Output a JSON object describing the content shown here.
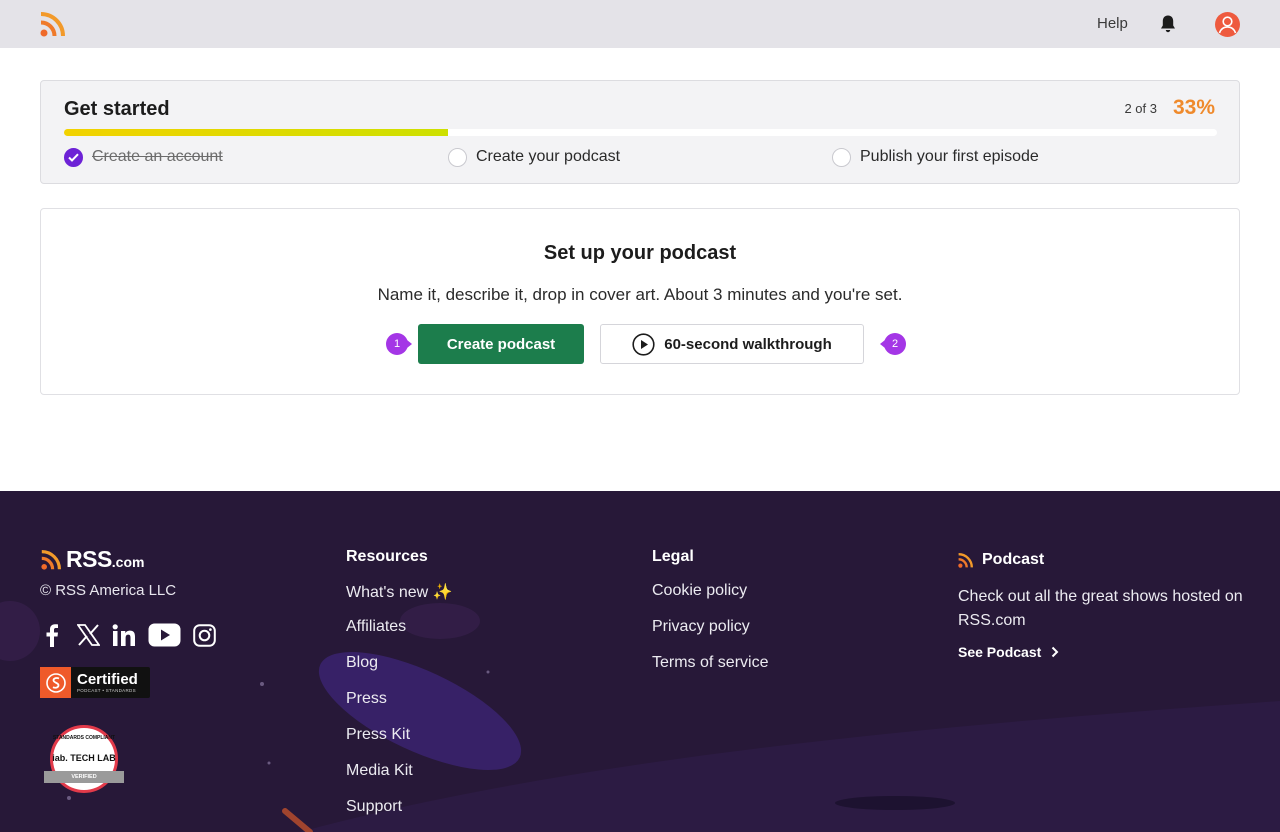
{
  "header": {
    "help_label": "Help"
  },
  "get_started": {
    "title": "Get started",
    "count_text": "2 of 3",
    "percent_text": "33%",
    "progress_fraction": 0.333,
    "steps": [
      {
        "label": "Create an account",
        "done": true
      },
      {
        "label": "Create your podcast",
        "done": false
      },
      {
        "label": "Publish your first episode",
        "done": false
      }
    ]
  },
  "setup": {
    "title": "Set up your podcast",
    "description": "Name it, describe it, drop in cover art. About 3 minutes and you're set.",
    "create_button": "Create podcast",
    "walkthrough_button": "60-second walkthrough",
    "marker_1": "1",
    "marker_2": "2"
  },
  "footer": {
    "logo_text": "RSS",
    "logo_suffix": ".com",
    "copyright": "© RSS America LLC",
    "social": [
      "facebook-icon",
      "x-icon",
      "linkedin-icon",
      "youtube-icon",
      "instagram-icon"
    ],
    "cert_label": "Certified",
    "cert_sub": "PODCAST • STANDARDS",
    "iab_top": "STANDARDS COMPLIANT",
    "iab_mid": "iab. TECH LAB",
    "iab_ribbon": "VERIFIED",
    "resources": {
      "title": "Resources",
      "items": [
        "What's new ✨",
        "Affiliates",
        "Blog",
        "Press",
        "Press Kit",
        "Media Kit",
        "Support"
      ]
    },
    "legal": {
      "title": "Legal",
      "items": [
        "Cookie policy",
        "Privacy policy",
        "Terms of service"
      ]
    },
    "podcast": {
      "title": "Podcast",
      "description": "Check out all the great shows hosted on RSS.com",
      "link": "See Podcast"
    }
  },
  "colors": {
    "accent_orange": "#ef8a2c",
    "progress_yellow": "#f2d200",
    "check_purple": "#6d22d6",
    "create_green": "#1c7d4c",
    "footer_bg": "#271838"
  }
}
